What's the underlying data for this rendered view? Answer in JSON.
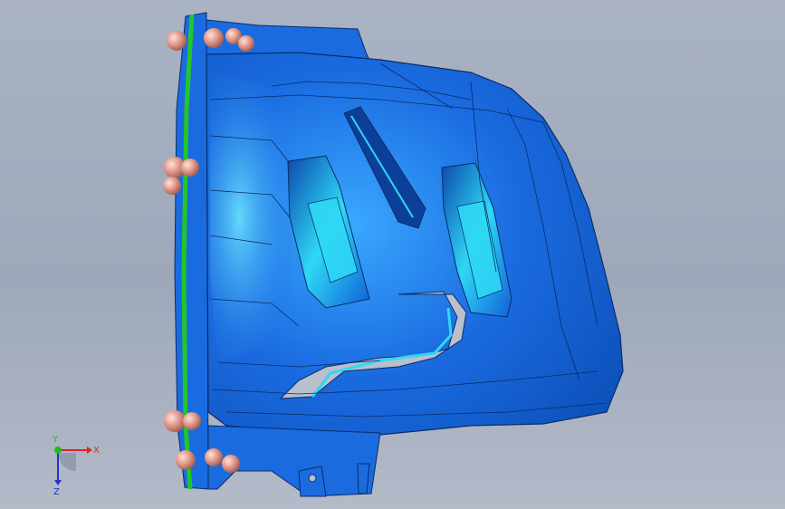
{
  "viewport": {
    "background_top": "#aab3c3",
    "background_bottom": "#b3bac8",
    "model_color": "#1a6be0",
    "model_highlight": "#2fd8f5",
    "flange_color": "#22c62a",
    "ball_color": "#e29a8c"
  },
  "triad": {
    "x_label": "X",
    "y_label": "Y",
    "z_label": "Z",
    "x_color": "#e52222",
    "y_color": "#22bb22",
    "z_color": "#2233cc"
  }
}
